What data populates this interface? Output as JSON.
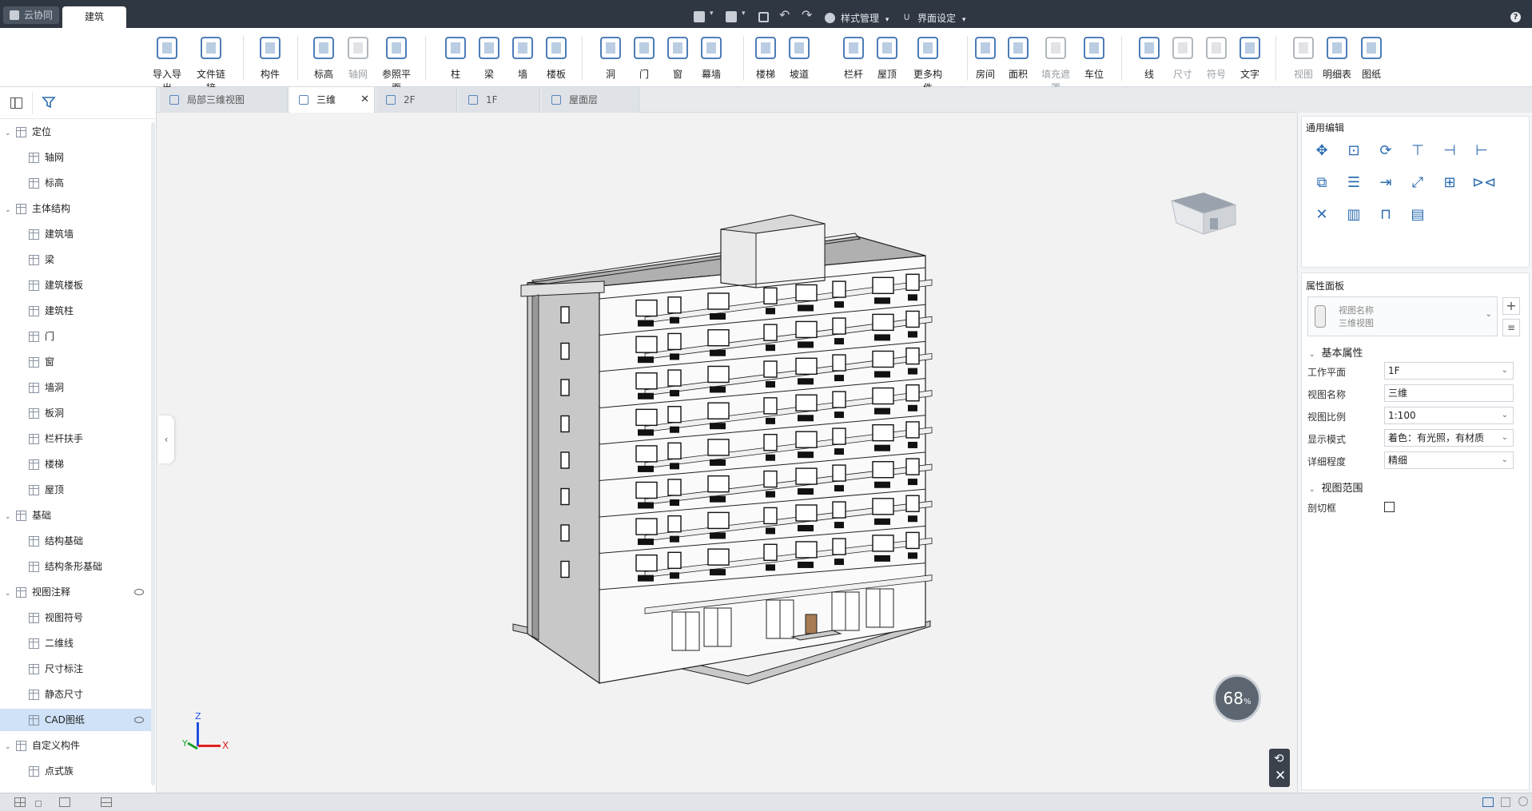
{
  "titlebar": {
    "cloud_tab": "云协同",
    "active_tab": "建筑",
    "style_menu": "样式管理",
    "ui_settings_menu": "界面设定",
    "help_icon": "question-icon"
  },
  "ribbon": {
    "buttons": [
      {
        "label": "导入导出",
        "icon": "cad-import-icon"
      },
      {
        "label": "文件链接",
        "icon": "file-link-icon"
      },
      {
        "label": "构件",
        "icon": "component-icon"
      },
      {
        "label": "标高",
        "icon": "level-icon"
      },
      {
        "label": "轴网",
        "icon": "grid-icon"
      },
      {
        "label": "参照平面",
        "icon": "ref-plane-icon"
      },
      {
        "label": "柱",
        "icon": "column-icon"
      },
      {
        "label": "梁",
        "icon": "beam-icon"
      },
      {
        "label": "墙",
        "icon": "wall-icon"
      },
      {
        "label": "楼板",
        "icon": "slab-icon"
      },
      {
        "label": "洞",
        "icon": "opening-icon"
      },
      {
        "label": "门",
        "icon": "door-icon"
      },
      {
        "label": "窗",
        "icon": "window-icon"
      },
      {
        "label": "幕墙",
        "icon": "curtain-wall-icon"
      },
      {
        "label": "楼梯",
        "icon": "stair-icon"
      },
      {
        "label": "坡道",
        "icon": "ramp-icon"
      },
      {
        "label": "栏杆",
        "icon": "railing-icon"
      },
      {
        "label": "屋顶",
        "icon": "roof-icon"
      },
      {
        "label": "更多构件",
        "icon": "more-components-icon"
      },
      {
        "label": "房间",
        "icon": "room-icon"
      },
      {
        "label": "面积",
        "icon": "area-icon"
      },
      {
        "label": "填充遮罩",
        "icon": "fill-mask-icon"
      },
      {
        "label": "车位",
        "icon": "parking-icon"
      },
      {
        "label": "线",
        "icon": "line-icon"
      },
      {
        "label": "尺寸",
        "icon": "dimension-icon"
      },
      {
        "label": "符号",
        "icon": "symbol-icon"
      },
      {
        "label": "文字",
        "icon": "text-icon"
      },
      {
        "label": "视图",
        "icon": "view-icon"
      },
      {
        "label": "明细表",
        "icon": "schedule-icon"
      },
      {
        "label": "图纸",
        "icon": "sheet-icon"
      }
    ]
  },
  "tree": {
    "groups": [
      {
        "label": "定位",
        "children": [
          "轴网",
          "标高"
        ]
      },
      {
        "label": "主体结构",
        "children": [
          "建筑墙",
          "梁",
          "建筑楼板",
          "建筑柱",
          "门",
          "窗",
          "墙洞",
          "板洞",
          "栏杆扶手",
          "楼梯",
          "屋顶"
        ]
      },
      {
        "label": "基础",
        "children": [
          "结构基础",
          "结构条形基础"
        ]
      },
      {
        "label": "视图注释",
        "children": [
          "视图符号",
          "二维线",
          "尺寸标注",
          "静态尺寸",
          "CAD图纸"
        ]
      },
      {
        "label": "自定义构件",
        "children": [
          "点式族"
        ]
      }
    ],
    "selected": "CAD图纸"
  },
  "view_tabs": [
    {
      "label": "局部三维视图",
      "active": false
    },
    {
      "label": "三维",
      "active": true
    },
    {
      "label": "2F",
      "active": false
    },
    {
      "label": "1F",
      "active": false
    },
    {
      "label": "屋面层",
      "active": false
    }
  ],
  "viewport": {
    "axis_x": "X",
    "axis_y": "Y",
    "axis_z": "Z",
    "zoom_percent": "68",
    "zoom_unit": "%"
  },
  "right_panel": {
    "edit_title": "通用编辑",
    "props_title": "属性面板",
    "view_name_label": "视图名称",
    "view_name_value": "三维视图",
    "basic_section": "基本属性",
    "range_section": "视图范围",
    "properties": [
      {
        "label": "工作平面",
        "value": "1F",
        "dropdown": true
      },
      {
        "label": "视图名称",
        "value": "三维",
        "dropdown": false
      },
      {
        "label": "视图比例",
        "value": "1:100",
        "dropdown": true
      },
      {
        "label": "显示模式",
        "value": "着色：有光照，有材质",
        "dropdown": true
      },
      {
        "label": "详细程度",
        "value": "精细",
        "dropdown": true
      }
    ],
    "section_box_label": "剖切框",
    "section_box_checked": false
  }
}
